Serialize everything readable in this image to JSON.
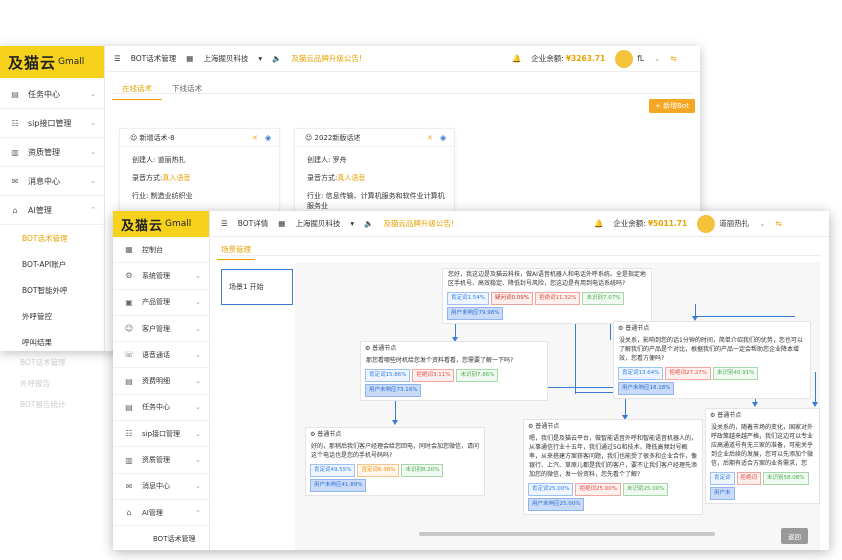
{
  "colors": {
    "brand": "#f7d21c",
    "accent": "#e8a200",
    "link": "#3a7bd5"
  },
  "brand": {
    "logo_mark": "及猫云",
    "logo_sub": "Gmall"
  },
  "winA": {
    "sidebar": [
      {
        "icon": "task-icon",
        "label": "任务中心"
      },
      {
        "icon": "sip-icon",
        "label": "sip接口管理"
      },
      {
        "icon": "resource-icon",
        "label": "资质管理"
      },
      {
        "icon": "message-icon",
        "label": "消息中心"
      },
      {
        "icon": "ai-icon",
        "label": "AI管理"
      }
    ],
    "subitems": [
      "BOT话术管理",
      "BOT-API账户",
      "BOT智能外呼",
      "外呼管控",
      "呼叫结果"
    ],
    "faded": [
      "BOT话术管理",
      "外呼报告",
      "BOT报告统计"
    ],
    "topbar": {
      "menu": "BOT话术管理",
      "company": "上海掘贝科技",
      "notice": "及猫云品牌升级公告!",
      "balance_label": "企业余额:",
      "balance": "¥3263.71",
      "user": "fL"
    },
    "tabs": [
      "在线话术",
      "下线话术"
    ],
    "new_button": "+ 新增Bot",
    "cards": [
      {
        "title": "新增话术-8",
        "creator": "创建人: 道丽热扎",
        "mode_label": "录音方式:",
        "mode": "真人语音",
        "industry": "行业: 制造业纺织业"
      },
      {
        "title": "2022新版话述",
        "creator": "创建人: 罗舟",
        "mode_label": "录音方式:",
        "mode": "真人语音",
        "industry": "行业: 信息传输、计算机服务和软件业计算机服务业"
      }
    ]
  },
  "winB": {
    "sidebar": [
      {
        "icon": "console-icon",
        "label": "控制台"
      },
      {
        "icon": "system-icon",
        "label": "系统管理"
      },
      {
        "icon": "product-icon",
        "label": "产品管理"
      },
      {
        "icon": "customer-icon",
        "label": "客户管理"
      },
      {
        "icon": "voice-icon",
        "label": "语音通话"
      },
      {
        "icon": "billing-icon",
        "label": "资费明细"
      },
      {
        "icon": "task-icon",
        "label": "任务中心"
      },
      {
        "icon": "sip-icon",
        "label": "sip接口管理"
      },
      {
        "icon": "resource-icon",
        "label": "资质管理"
      },
      {
        "icon": "message-icon",
        "label": "消息中心"
      },
      {
        "icon": "ai-icon",
        "label": "AI管理"
      },
      {
        "icon": "",
        "label": "BOT话术管理"
      }
    ],
    "topbar": {
      "menu": "BOT详情",
      "company": "上海掘贝科技",
      "notice": "及猫云品牌升级公告!",
      "balance_label": "企业余额:",
      "balance": "¥5011.71",
      "user": "道丽热扎"
    },
    "tab": "场景管理",
    "scene": "场景1 开始",
    "back": "返回",
    "nodes": [
      {
        "title": "",
        "text": "您好，我这边是及猫云科技，做AI语音机器人和电话外呼系统。全是指定地区手机号、高效稳定、降低封号风险，您这边是有用到电话系统吗?",
        "tags": [
          [
            "t-yes",
            "肯定词1.54%"
          ],
          [
            "t-amb",
            "疑问词0.09%"
          ],
          [
            "t-no",
            "拒绝词11.32%"
          ],
          [
            "t-unk",
            "未识别7.07%"
          ],
          [
            "t-usr",
            "用户未响应79.98%"
          ]
        ]
      },
      {
        "title": "普通节点",
        "text": "那您看哪些时机给您发个资料看看，您需要了解一下吗?",
        "tags": [
          [
            "t-yes",
            "肯定词15.86%"
          ],
          [
            "t-no",
            "拒绝词3.11%"
          ],
          [
            "t-unk",
            "未识别7.86%"
          ],
          [
            "t-usr",
            "用户未响应73.16%"
          ]
        ]
      },
      {
        "title": "普通节点",
        "text": "没关系，影响到您的话1分钟的时间，简单介绍我们的优势，您也可以了解我们的产品是个对比，根据我们的产品一定会帮助您企业降本增效，您看方便吗?",
        "tags": [
          [
            "t-yes",
            "肯定词13.64%"
          ],
          [
            "t-no",
            "拒绝词27.27%"
          ],
          [
            "t-unk",
            "未识别40.91%"
          ],
          [
            "t-usr",
            "用户未响应18.18%"
          ]
        ]
      },
      {
        "title": "普通节点",
        "text": "好的，那稍后我们客户经理会给您回电，同时会加您微信，请问这个电话也是您的手机号码吗?",
        "tags": [
          [
            "t-yes",
            "肯定词49.55%"
          ],
          [
            "t-mid",
            "否定词6.36%"
          ],
          [
            "t-unk",
            "未识别8.20%"
          ],
          [
            "t-usr",
            "用户未响应41.89%"
          ]
        ]
      },
      {
        "title": "普通节点",
        "text": "嗯，我们是及猫云平台，做智能语音外呼和智能语音机器人的，从事通信行业十五年，我们通过5G和技术，降低高频封号概率，从来搭建方案获客问题，我们也能受了很多和企业合作，像银行、上汽、草原儿都是我们的客户，要不让我们客户经理先添加您的微信，发一份资料，您先看个了解?",
        "tags": [
          [
            "t-yes",
            "肯定词25.00%"
          ],
          [
            "t-no",
            "拒绝词25.00%"
          ],
          [
            "t-unk",
            "未识别25.00%"
          ],
          [
            "t-usr",
            "用户未响应25.00%"
          ]
        ]
      },
      {
        "title": "普通节点",
        "text": "没关系的，随着市场的变化，国家对外呼政策越来越严格，我们这边可以专业应高通道号有无三家的准备，可能关乎到企业后续的发展，您可以先添加个微信，后期有适合方案的业务需求，您",
        "tags": [
          [
            "t-yes",
            "肯定词"
          ],
          [
            "t-no",
            "拒绝词"
          ],
          [
            "t-unk",
            "未识别58.08%"
          ],
          [
            "t-usr",
            "用户未"
          ]
        ]
      }
    ]
  }
}
